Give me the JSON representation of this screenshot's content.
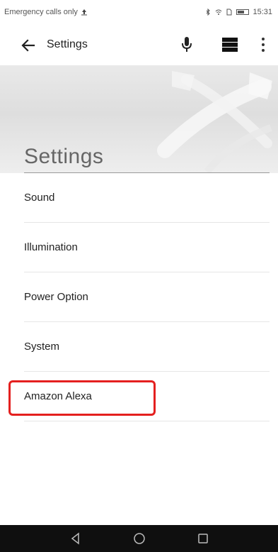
{
  "status_bar": {
    "carrier": "Emergency calls only",
    "time": "15:31"
  },
  "toolbar": {
    "title": "Settings",
    "back_icon": "arrow-left-icon",
    "mic_icon": "microphone-icon",
    "layout_icon": "view-list-icon",
    "more_icon": "more-vertical-icon"
  },
  "hero": {
    "title": "Settings"
  },
  "menu": {
    "items": [
      {
        "label": "Sound"
      },
      {
        "label": "Illumination"
      },
      {
        "label": "Power Option"
      },
      {
        "label": "System"
      },
      {
        "label": "Amazon Alexa"
      }
    ]
  },
  "nav": {
    "back_icon": "nav-back-icon",
    "home_icon": "nav-home-icon",
    "recents_icon": "nav-recents-icon"
  },
  "colors": {
    "highlight": "#e4201f",
    "nav_bar": "#0f0f0f"
  }
}
